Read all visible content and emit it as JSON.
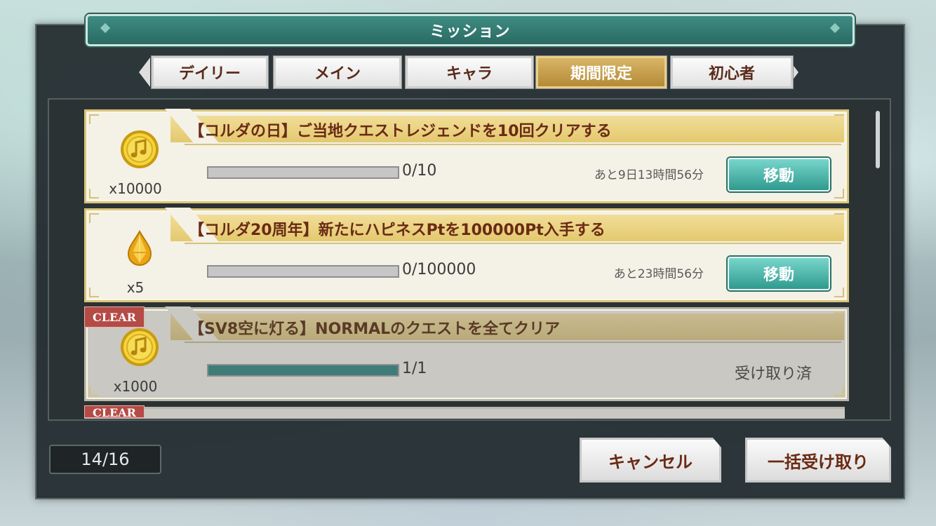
{
  "title": "ミッション",
  "tabs": [
    {
      "label": "デイリー",
      "active": false
    },
    {
      "label": "メイン",
      "active": false
    },
    {
      "label": "キャラ",
      "active": false
    },
    {
      "label": "期間限定",
      "active": true
    },
    {
      "label": "初心者",
      "active": false
    }
  ],
  "missions": [
    {
      "title": "【コルダの日】ご当地クエストレジェンドを10回クリアする",
      "reward_icon": "music-note-coin-icon",
      "reward_count": "x10000",
      "progress_text": "0/10",
      "progress": 0,
      "deadline": "あと9日13時間56分",
      "button_label": "移動",
      "cleared": false
    },
    {
      "title": "【コルダ20周年】新たにハピネスPtを100000Pt入手する",
      "reward_icon": "yellow-gem-icon",
      "reward_count": "x5",
      "progress_text": "0/100000",
      "progress": 0,
      "deadline": "あと23時間56分",
      "button_label": "移動",
      "cleared": false
    },
    {
      "title": "【SV8空に灯る】NORMALのクエストを全てクリア",
      "reward_icon": "music-note-coin-icon",
      "reward_count": "x1000",
      "progress_text": "1/1",
      "progress": 1,
      "status": "受け取り済",
      "cleared": true,
      "badge": "CLEAR"
    }
  ],
  "partial_badge": "CLEAR",
  "page_count": "14/16",
  "footer": {
    "cancel_label": "キャンセル",
    "claim_all_label": "一括受け取り"
  },
  "colors": {
    "accent_teal": "#2f9a8f",
    "active_tab_gold": "#c29a45",
    "title_brown": "#6a2a14",
    "clear_red": "#b44b46"
  }
}
